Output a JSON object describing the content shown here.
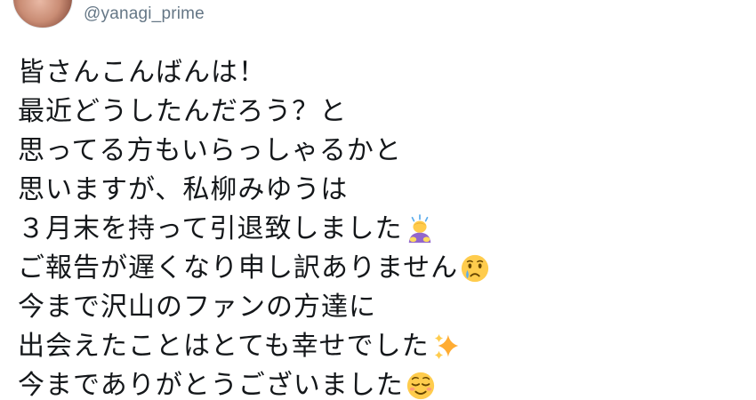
{
  "tweet": {
    "handle": "@yanagi_prime",
    "lines": [
      {
        "text": "皆さんこんばんは！",
        "emoji": null
      },
      {
        "text": "最近どうしたんだろう？と",
        "emoji": null
      },
      {
        "text": "思ってる方もいらっしゃるかと",
        "emoji": null
      },
      {
        "text": "思いますが、私柳みゆうは",
        "emoji": null
      },
      {
        "text": "３月末を持って引退致しました",
        "emoji": "person-bowing-icon"
      },
      {
        "text": "ご報告が遅くなり申し訳ありません",
        "emoji": "crying-face-icon"
      },
      {
        "text": "今まで沢山のファンの方達に",
        "emoji": null
      },
      {
        "text": "出会えたことはとても幸せでした",
        "emoji": "sparkles-icon"
      },
      {
        "text": "今までありがとうございました",
        "emoji": "relieved-face-icon"
      }
    ]
  },
  "colors": {
    "text": "#14171a",
    "handle": "#657786",
    "background": "#ffffff"
  }
}
